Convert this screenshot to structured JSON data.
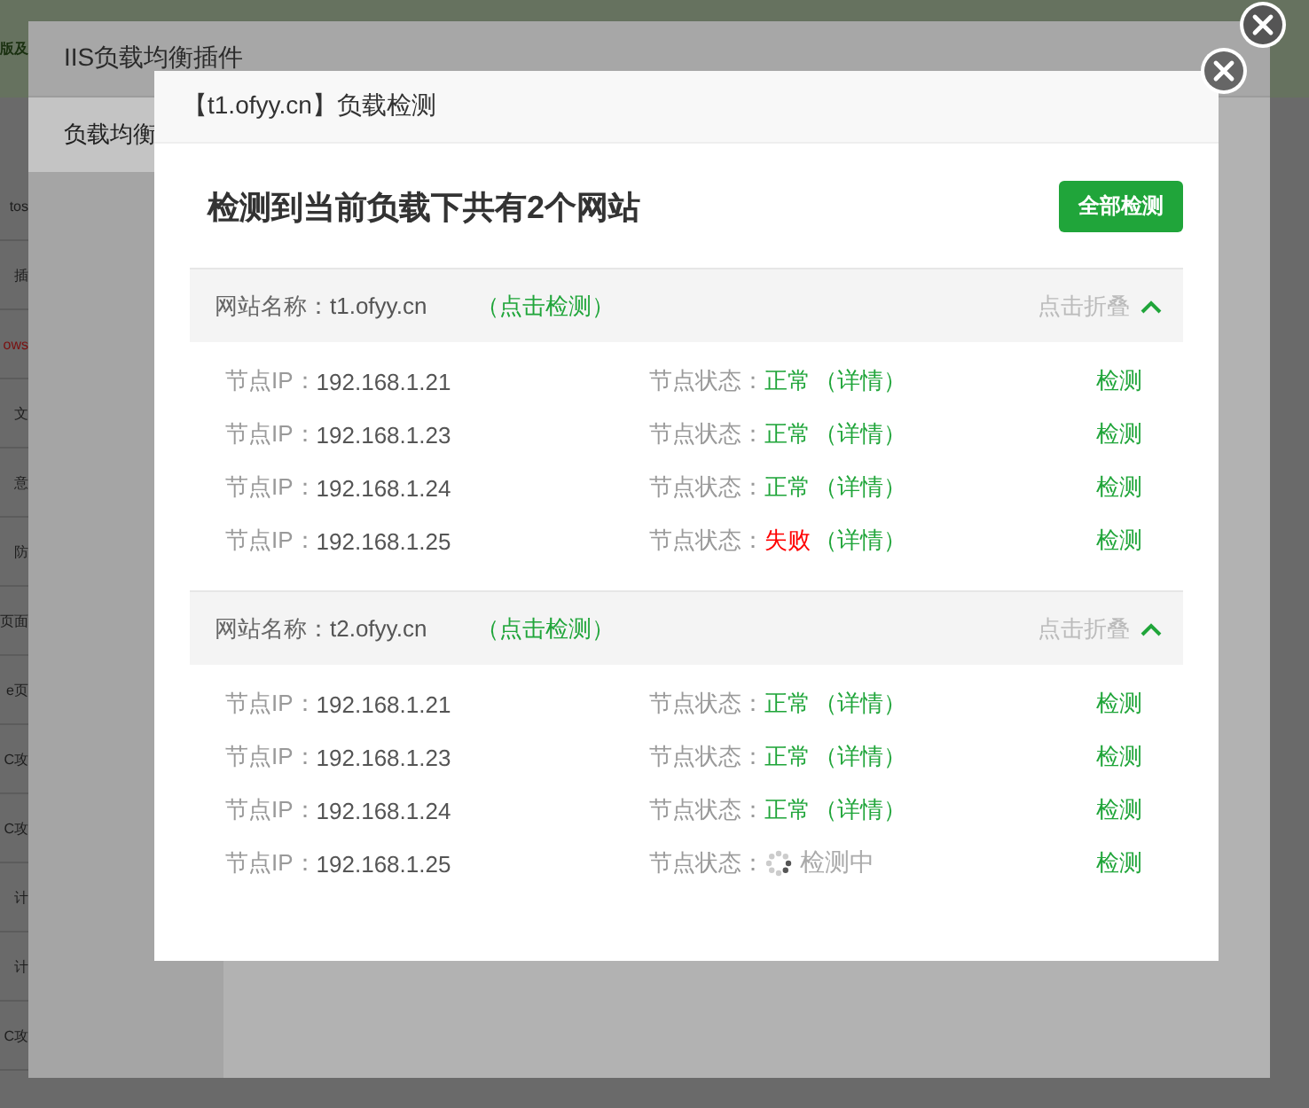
{
  "background_page": {
    "banner_text": "版及",
    "sidebar_items": [
      {
        "label": "tos",
        "color": "#1e1e1e"
      },
      {
        "label": "插",
        "color": "#1e1e1e"
      },
      {
        "label": "ows",
        "color": "#7a1010"
      },
      {
        "label": "文",
        "color": "#1e1e1e"
      },
      {
        "label": "意",
        "color": "#1e1e1e"
      },
      {
        "label": "防",
        "color": "#1e1e1e"
      },
      {
        "label": "页面",
        "color": "#1e1e1e"
      },
      {
        "label": "e页",
        "color": "#1e1e1e"
      },
      {
        "label": "C攻",
        "color": "#1e1e1e"
      },
      {
        "label": "C攻",
        "color": "#1e1e1e"
      },
      {
        "label": "计",
        "color": "#1e1e1e"
      },
      {
        "label": "计",
        "color": "#1e1e1e"
      },
      {
        "label": "C攻",
        "color": "#1e1e1e"
      }
    ]
  },
  "plugin_window": {
    "title": "IIS负载均衡插件",
    "tabs": [
      {
        "label": "负载均衡",
        "selected": true
      }
    ]
  },
  "dialog": {
    "title": "【t1.ofyy.cn】负载检测",
    "heading": "检测到当前负载下共有2个网站",
    "check_all_button": "全部检测",
    "sites": [
      {
        "name_label": "网站名称：",
        "name": "t1.ofyy.cn",
        "check_link": "（点击检测）",
        "collapse_label": "点击折叠",
        "expanded": true,
        "nodes": [
          {
            "ip_label": "节点IP：",
            "ip": "192.168.1.21",
            "status_label": "节点状态：",
            "status": "正常",
            "kind": "normal",
            "detail_link": "（详情）",
            "check_link": "检测"
          },
          {
            "ip_label": "节点IP：",
            "ip": "192.168.1.23",
            "status_label": "节点状态：",
            "status": "正常",
            "kind": "normal",
            "detail_link": "（详情）",
            "check_link": "检测"
          },
          {
            "ip_label": "节点IP：",
            "ip": "192.168.1.24",
            "status_label": "节点状态：",
            "status": "正常",
            "kind": "normal",
            "detail_link": "（详情）",
            "check_link": "检测"
          },
          {
            "ip_label": "节点IP：",
            "ip": "192.168.1.25",
            "status_label": "节点状态：",
            "status": "失败",
            "kind": "failed",
            "detail_link": "（详情）",
            "check_link": "检测"
          }
        ]
      },
      {
        "name_label": "网站名称：",
        "name": "t2.ofyy.cn",
        "check_link": "（点击检测）",
        "collapse_label": "点击折叠",
        "expanded": true,
        "nodes": [
          {
            "ip_label": "节点IP：",
            "ip": "192.168.1.21",
            "status_label": "节点状态：",
            "status": "正常",
            "kind": "normal",
            "detail_link": "（详情）",
            "check_link": "检测"
          },
          {
            "ip_label": "节点IP：",
            "ip": "192.168.1.23",
            "status_label": "节点状态：",
            "status": "正常",
            "kind": "normal",
            "detail_link": "（详情）",
            "check_link": "检测"
          },
          {
            "ip_label": "节点IP：",
            "ip": "192.168.1.24",
            "status_label": "节点状态：",
            "status": "正常",
            "kind": "normal",
            "detail_link": "（详情）",
            "check_link": "检测"
          },
          {
            "ip_label": "节点IP：",
            "ip": "192.168.1.25",
            "status_label": "节点状态：",
            "status": "检测中",
            "kind": "checking",
            "check_link": "检测"
          }
        ]
      }
    ]
  }
}
